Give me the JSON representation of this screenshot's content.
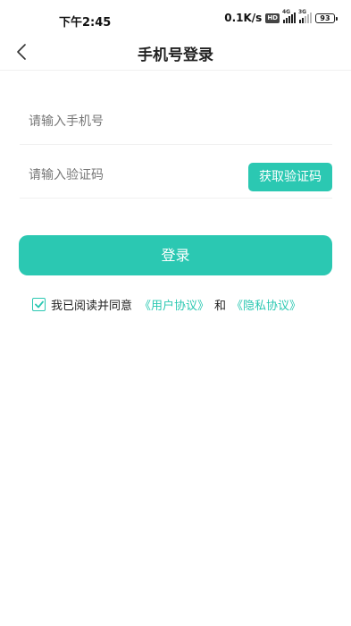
{
  "status_bar": {
    "time": "下午2:45",
    "net_speed": "0.1K/s",
    "hd": "HD",
    "sim1_net": "4G",
    "sim2_net": "3G",
    "battery": "93"
  },
  "nav": {
    "title": "手机号登录",
    "back_icon": "chevron-left-icon"
  },
  "form": {
    "phone_placeholder": "请输入手机号",
    "phone_value": "",
    "code_placeholder": "请输入验证码",
    "code_value": "",
    "get_code_label": "获取验证码",
    "login_label": "登录"
  },
  "agreement": {
    "checked": true,
    "prefix": "我已阅读并同意",
    "user_agreement": "《用户协议》",
    "and": "和",
    "privacy_policy": "《隐私协议》"
  },
  "colors": {
    "accent": "#2bc8b2"
  }
}
